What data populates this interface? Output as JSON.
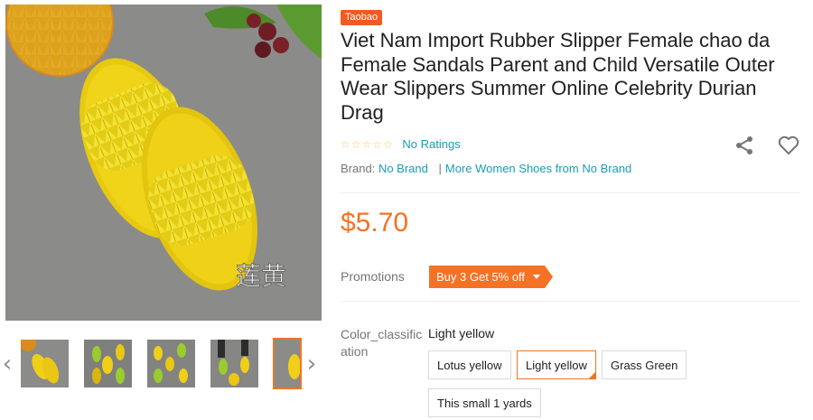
{
  "gallery": {
    "main_image_caption": "莲黄",
    "prev_icon": "chevron-left-icon",
    "next_icon": "chevron-right-icon",
    "thumbnail_count": 5,
    "active_thumbnail": 5
  },
  "product": {
    "source_badge": "Taobao",
    "title": "Viet Nam Import Rubber Slipper Female chao da Female Sandals Parent and Child Versatile Outer Wear Slippers Summer Online Celebrity Durian Drag",
    "ratings_text": "No Ratings",
    "stars": "☆☆☆☆☆",
    "brand_label": "Brand:",
    "brand_name": "No Brand",
    "brand_separator": "|",
    "more_from_brand": "More Women Shoes from No Brand",
    "price": "$5.70",
    "promotions_label": "Promotions",
    "promotion": "Buy 3 Get 5% off"
  },
  "variants": {
    "label": "Color_classification",
    "selected": "Light yellow",
    "options": [
      "Lotus yellow",
      "Light yellow",
      "Grass Green",
      "This small 1 yards"
    ],
    "selected_index": 1
  },
  "colors": {
    "accent": "#f57224",
    "link": "#1a9cb7",
    "badge": "#f15a22"
  }
}
